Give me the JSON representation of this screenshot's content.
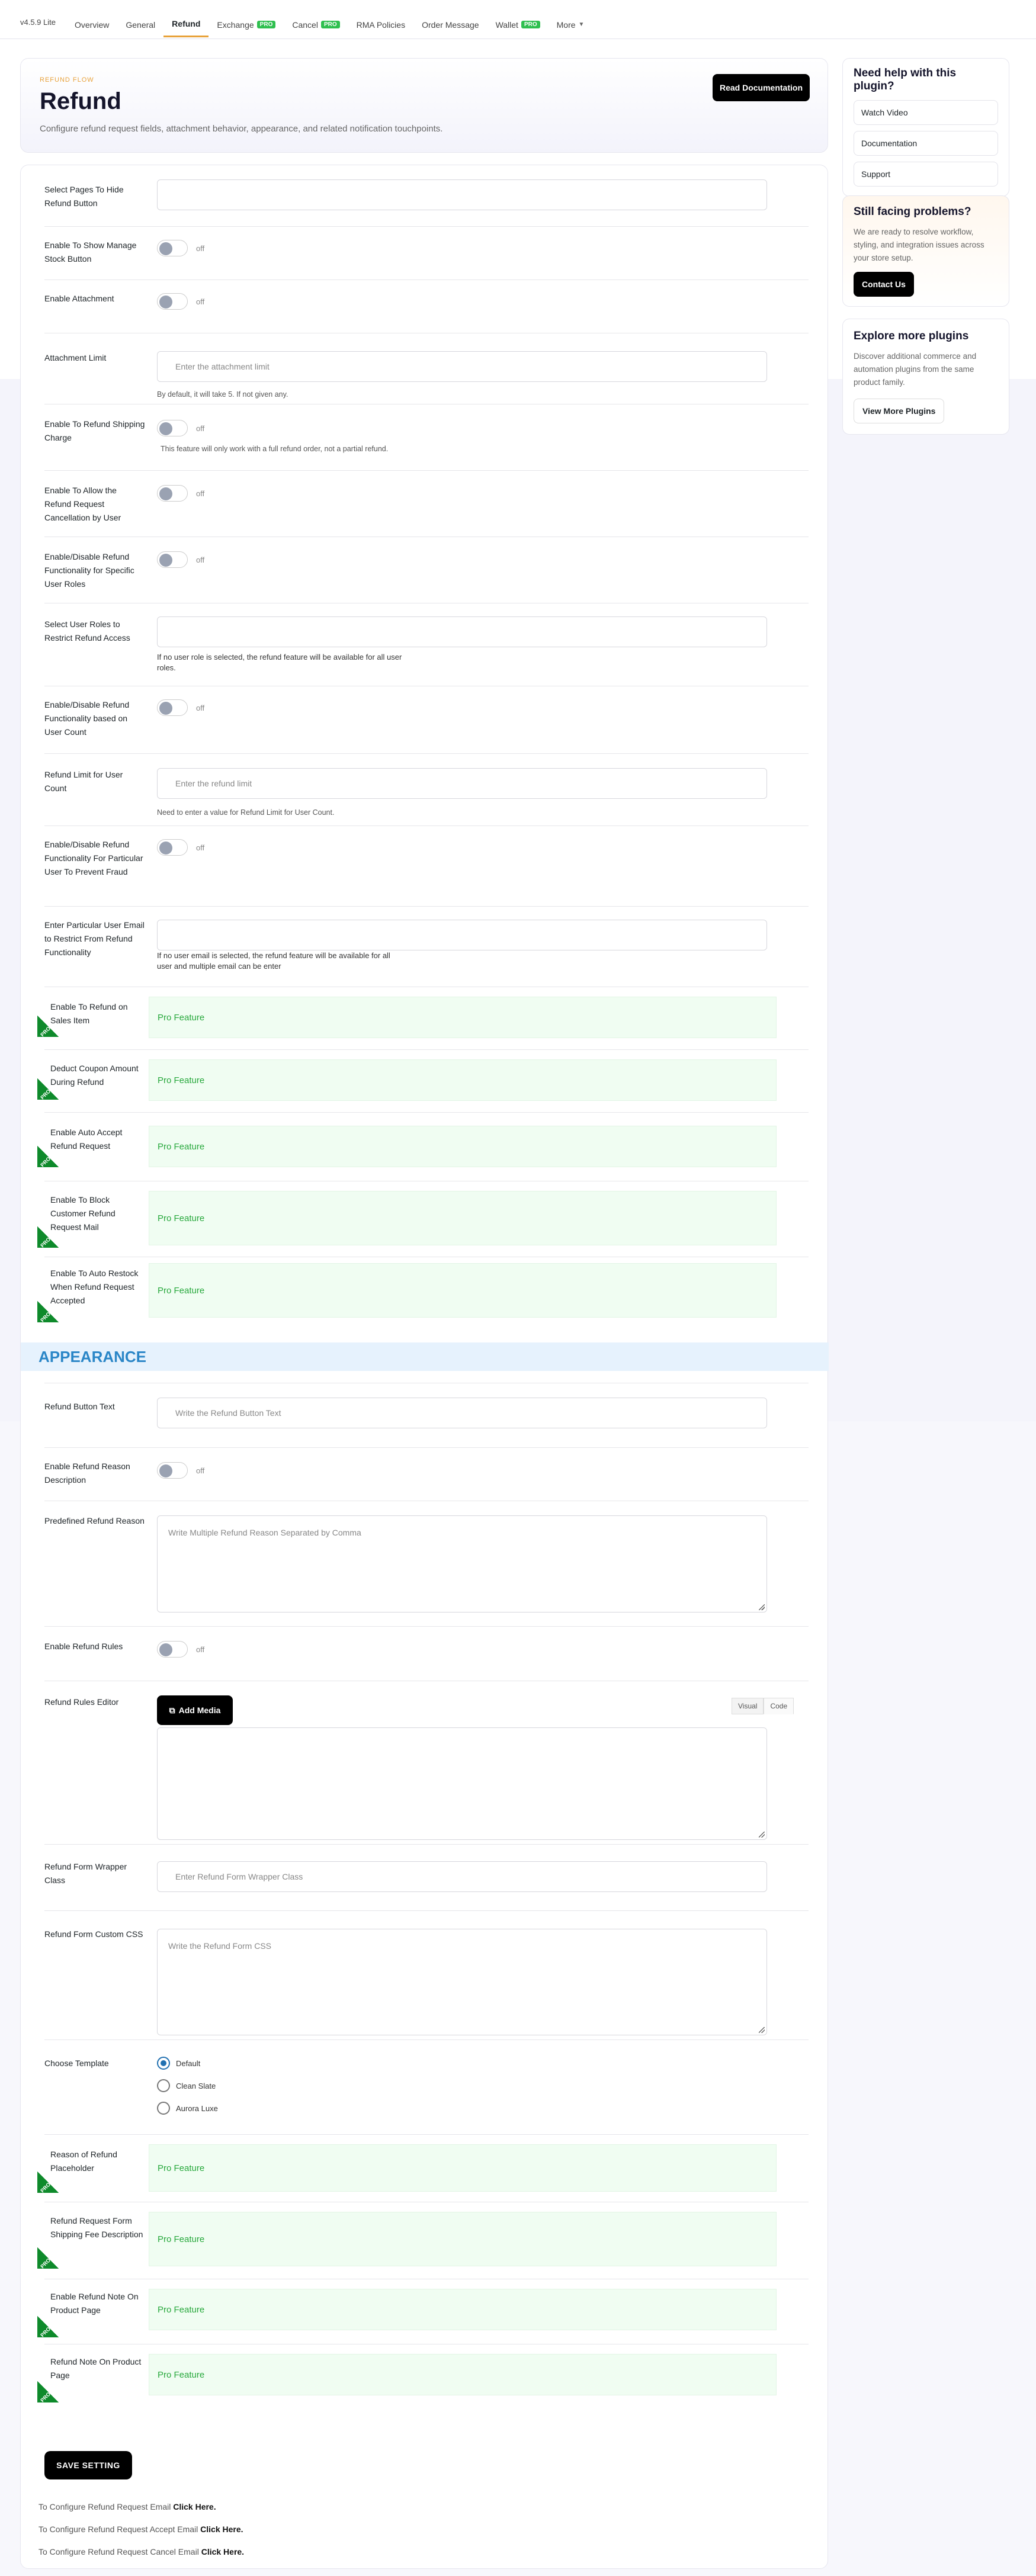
{
  "nav": {
    "version": "v4.5.9 Lite",
    "tabs": [
      {
        "label": "Overview"
      },
      {
        "label": "General"
      },
      {
        "label": "Refund"
      },
      {
        "label": "Exchange",
        "badge": "PRO"
      },
      {
        "label": "Cancel",
        "badge": "PRO"
      },
      {
        "label": "RMA Policies"
      },
      {
        "label": "Order Message"
      },
      {
        "label": "Wallet",
        "badge": "PRO"
      },
      {
        "label": "More"
      }
    ]
  },
  "hero": {
    "tag": "REFUND FLOW",
    "title": "Refund",
    "desc": "Configure refund request fields, attachment behavior, appearance, and related notification touchpoints.",
    "doc_btn": "Read Documentation"
  },
  "fields": {
    "hide_pages": "Select Pages To Hide Refund Button",
    "manage_stock": "Enable To Show Manage Stock Button",
    "attachment": "Enable Attachment",
    "attach_limit": "Attachment Limit",
    "attach_limit_ph": "Enter the attachment limit",
    "attach_limit_help": "By default, it will take 5. If not given any.",
    "shipping": "Enable To Refund Shipping Charge",
    "shipping_help": "This feature will only work with a full refund order, not a partial refund.",
    "cancel_by_user": "Enable To Allow the Refund Request Cancellation by User",
    "specific_roles": "Enable/Disable Refund Functionality for Specific User Roles",
    "restrict_roles": "Select User Roles to Restrict Refund Access",
    "restrict_roles_help": "If no user role is selected, the refund feature will be available for all user roles.",
    "user_count": "Enable/Disable Refund Functionality based on User Count",
    "user_limit": "Refund Limit for User Count",
    "user_limit_ph": "Enter the refund limit",
    "user_limit_help": "Need to enter a value for Refund Limit for User Count.",
    "fraud": "Enable/Disable Refund Functionality For Particular User To Prevent Fraud",
    "restrict_email": "Enter Particular User Email to Restrict From Refund Functionality",
    "restrict_email_help": "If no user email is selected, the refund feature will be available for all user and multiple email can be enter",
    "pro_sales": "Enable To Refund on Sales Item",
    "pro_coupon": "Deduct Coupon Amount During Refund",
    "pro_auto_accept": "Enable Auto Accept Refund Request",
    "pro_block_mail": "Enable To Block Customer Refund Request Mail",
    "pro_restock": "Enable To Auto Restock When Refund Request Accepted",
    "appearance": "APPEARANCE",
    "btn_text": "Refund Button Text",
    "btn_text_ph": "Write the Refund Button Text",
    "reason_desc": "Enable Refund Reason Description",
    "predefined": "Predefined Refund Reason",
    "predefined_ph": "Write Multiple Refund Reason Separated by Comma",
    "rules": "Enable Refund Rules",
    "rules_editor": "Refund Rules Editor",
    "add_media": "Add Media",
    "visual": "Visual",
    "code": "Code",
    "wrapper": "Refund Form Wrapper Class",
    "wrapper_ph": "Enter Refund Form Wrapper Class",
    "css": "Refund Form Custom CSS",
    "css_ph": "Write the Refund Form CSS",
    "template": "Choose Template",
    "templates": [
      "Default",
      "Clean Slate",
      "Aurora Luxe"
    ],
    "pro_placeholder": "Reason of Refund Placeholder",
    "pro_shipping_fee": "Refund Request Form Shipping Fee Description",
    "pro_note_product": "Enable Refund Note On Product Page",
    "pro_note_page": "Refund Note On Product Page",
    "pro_feature": "Pro Feature",
    "pro": "PRO",
    "off": "off",
    "save": "SAVE SETTING"
  },
  "footer": {
    "l1": "To Configure Refund Request Email",
    "l2": "To Configure Refund Request Accept Email",
    "l3": "To Configure Refund Request Cancel Email",
    "click": "Click Here."
  },
  "sidebar": {
    "help_title": "Need help with this plugin?",
    "links": [
      "Watch Video",
      "Documentation",
      "Support"
    ],
    "prob_title": "Still facing problems?",
    "prob_desc": "We are ready to resolve workflow, styling, and integration issues across your store setup.",
    "contact": "Contact Us",
    "explore_title": "Explore more plugins",
    "explore_desc": "Discover additional commerce and automation plugins from the same product family.",
    "view_more": "View More Plugins"
  }
}
